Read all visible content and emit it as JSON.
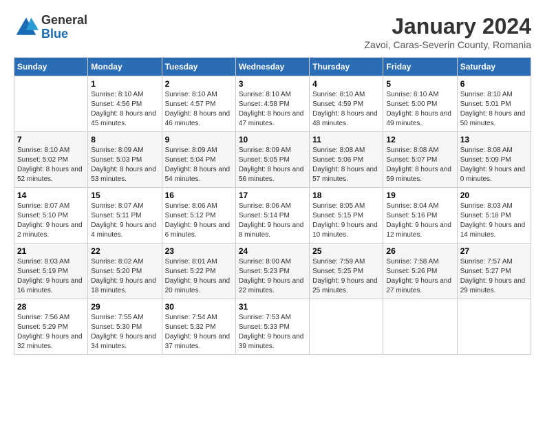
{
  "header": {
    "logo": {
      "general": "General",
      "blue": "Blue"
    },
    "title": "January 2024",
    "subtitle": "Zavoi, Caras-Severin County, Romania"
  },
  "calendar": {
    "headers": [
      "Sunday",
      "Monday",
      "Tuesday",
      "Wednesday",
      "Thursday",
      "Friday",
      "Saturday"
    ],
    "weeks": [
      [
        {
          "day": "",
          "sunrise": "",
          "sunset": "",
          "daylight": ""
        },
        {
          "day": "1",
          "sunrise": "Sunrise: 8:10 AM",
          "sunset": "Sunset: 4:56 PM",
          "daylight": "Daylight: 8 hours and 45 minutes."
        },
        {
          "day": "2",
          "sunrise": "Sunrise: 8:10 AM",
          "sunset": "Sunset: 4:57 PM",
          "daylight": "Daylight: 8 hours and 46 minutes."
        },
        {
          "day": "3",
          "sunrise": "Sunrise: 8:10 AM",
          "sunset": "Sunset: 4:58 PM",
          "daylight": "Daylight: 8 hours and 47 minutes."
        },
        {
          "day": "4",
          "sunrise": "Sunrise: 8:10 AM",
          "sunset": "Sunset: 4:59 PM",
          "daylight": "Daylight: 8 hours and 48 minutes."
        },
        {
          "day": "5",
          "sunrise": "Sunrise: 8:10 AM",
          "sunset": "Sunset: 5:00 PM",
          "daylight": "Daylight: 8 hours and 49 minutes."
        },
        {
          "day": "6",
          "sunrise": "Sunrise: 8:10 AM",
          "sunset": "Sunset: 5:01 PM",
          "daylight": "Daylight: 8 hours and 50 minutes."
        }
      ],
      [
        {
          "day": "7",
          "sunrise": "Sunrise: 8:10 AM",
          "sunset": "Sunset: 5:02 PM",
          "daylight": "Daylight: 8 hours and 52 minutes."
        },
        {
          "day": "8",
          "sunrise": "Sunrise: 8:09 AM",
          "sunset": "Sunset: 5:03 PM",
          "daylight": "Daylight: 8 hours and 53 minutes."
        },
        {
          "day": "9",
          "sunrise": "Sunrise: 8:09 AM",
          "sunset": "Sunset: 5:04 PM",
          "daylight": "Daylight: 8 hours and 54 minutes."
        },
        {
          "day": "10",
          "sunrise": "Sunrise: 8:09 AM",
          "sunset": "Sunset: 5:05 PM",
          "daylight": "Daylight: 8 hours and 56 minutes."
        },
        {
          "day": "11",
          "sunrise": "Sunrise: 8:08 AM",
          "sunset": "Sunset: 5:06 PM",
          "daylight": "Daylight: 8 hours and 57 minutes."
        },
        {
          "day": "12",
          "sunrise": "Sunrise: 8:08 AM",
          "sunset": "Sunset: 5:07 PM",
          "daylight": "Daylight: 8 hours and 59 minutes."
        },
        {
          "day": "13",
          "sunrise": "Sunrise: 8:08 AM",
          "sunset": "Sunset: 5:09 PM",
          "daylight": "Daylight: 9 hours and 0 minutes."
        }
      ],
      [
        {
          "day": "14",
          "sunrise": "Sunrise: 8:07 AM",
          "sunset": "Sunset: 5:10 PM",
          "daylight": "Daylight: 9 hours and 2 minutes."
        },
        {
          "day": "15",
          "sunrise": "Sunrise: 8:07 AM",
          "sunset": "Sunset: 5:11 PM",
          "daylight": "Daylight: 9 hours and 4 minutes."
        },
        {
          "day": "16",
          "sunrise": "Sunrise: 8:06 AM",
          "sunset": "Sunset: 5:12 PM",
          "daylight": "Daylight: 9 hours and 6 minutes."
        },
        {
          "day": "17",
          "sunrise": "Sunrise: 8:06 AM",
          "sunset": "Sunset: 5:14 PM",
          "daylight": "Daylight: 9 hours and 8 minutes."
        },
        {
          "day": "18",
          "sunrise": "Sunrise: 8:05 AM",
          "sunset": "Sunset: 5:15 PM",
          "daylight": "Daylight: 9 hours and 10 minutes."
        },
        {
          "day": "19",
          "sunrise": "Sunrise: 8:04 AM",
          "sunset": "Sunset: 5:16 PM",
          "daylight": "Daylight: 9 hours and 12 minutes."
        },
        {
          "day": "20",
          "sunrise": "Sunrise: 8:03 AM",
          "sunset": "Sunset: 5:18 PM",
          "daylight": "Daylight: 9 hours and 14 minutes."
        }
      ],
      [
        {
          "day": "21",
          "sunrise": "Sunrise: 8:03 AM",
          "sunset": "Sunset: 5:19 PM",
          "daylight": "Daylight: 9 hours and 16 minutes."
        },
        {
          "day": "22",
          "sunrise": "Sunrise: 8:02 AM",
          "sunset": "Sunset: 5:20 PM",
          "daylight": "Daylight: 9 hours and 18 minutes."
        },
        {
          "day": "23",
          "sunrise": "Sunrise: 8:01 AM",
          "sunset": "Sunset: 5:22 PM",
          "daylight": "Daylight: 9 hours and 20 minutes."
        },
        {
          "day": "24",
          "sunrise": "Sunrise: 8:00 AM",
          "sunset": "Sunset: 5:23 PM",
          "daylight": "Daylight: 9 hours and 22 minutes."
        },
        {
          "day": "25",
          "sunrise": "Sunrise: 7:59 AM",
          "sunset": "Sunset: 5:25 PM",
          "daylight": "Daylight: 9 hours and 25 minutes."
        },
        {
          "day": "26",
          "sunrise": "Sunrise: 7:58 AM",
          "sunset": "Sunset: 5:26 PM",
          "daylight": "Daylight: 9 hours and 27 minutes."
        },
        {
          "day": "27",
          "sunrise": "Sunrise: 7:57 AM",
          "sunset": "Sunset: 5:27 PM",
          "daylight": "Daylight: 9 hours and 29 minutes."
        }
      ],
      [
        {
          "day": "28",
          "sunrise": "Sunrise: 7:56 AM",
          "sunset": "Sunset: 5:29 PM",
          "daylight": "Daylight: 9 hours and 32 minutes."
        },
        {
          "day": "29",
          "sunrise": "Sunrise: 7:55 AM",
          "sunset": "Sunset: 5:30 PM",
          "daylight": "Daylight: 9 hours and 34 minutes."
        },
        {
          "day": "30",
          "sunrise": "Sunrise: 7:54 AM",
          "sunset": "Sunset: 5:32 PM",
          "daylight": "Daylight: 9 hours and 37 minutes."
        },
        {
          "day": "31",
          "sunrise": "Sunrise: 7:53 AM",
          "sunset": "Sunset: 5:33 PM",
          "daylight": "Daylight: 9 hours and 39 minutes."
        },
        {
          "day": "",
          "sunrise": "",
          "sunset": "",
          "daylight": ""
        },
        {
          "day": "",
          "sunrise": "",
          "sunset": "",
          "daylight": ""
        },
        {
          "day": "",
          "sunrise": "",
          "sunset": "",
          "daylight": ""
        }
      ]
    ]
  }
}
